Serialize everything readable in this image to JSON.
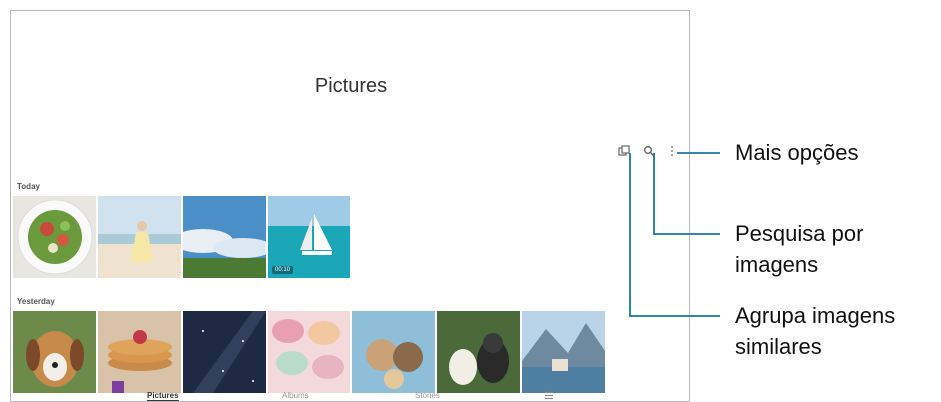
{
  "app": {
    "title": "Pictures"
  },
  "sections": {
    "today": "Today",
    "yesterday": "Yesterday"
  },
  "thumb_badge": "00:10",
  "navbar": {
    "pictures": "Pictures",
    "albums": "Albums",
    "stories": "Stories",
    "menu_icon": "hamburger-icon"
  },
  "top_icons": [
    "group-similar-icon",
    "search-icon",
    "more-options-icon"
  ],
  "callouts": {
    "more_options": "Mais opções",
    "search_line1": "Pesquisa por",
    "search_line2": "imagens",
    "group_line1": "Agrupa imagens",
    "group_line2": "similares"
  },
  "colors": {
    "accent_line": "#1b74a8",
    "border": "#b9b9b9"
  }
}
